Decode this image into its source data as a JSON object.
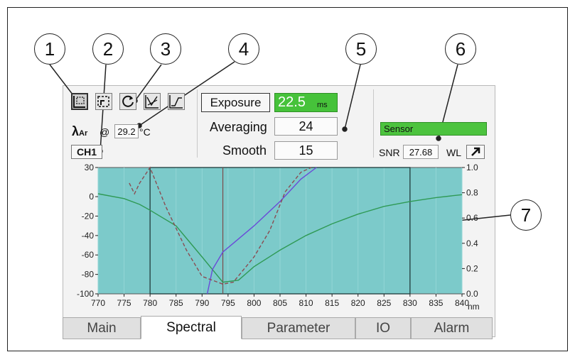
{
  "callouts": [
    "1",
    "2",
    "3",
    "4",
    "5",
    "6",
    "7"
  ],
  "toolbar": {
    "icons": [
      "zoom-rect-icon",
      "zoom-reset-icon",
      "refresh-icon",
      "curve-icon",
      "peak-icon"
    ]
  },
  "sensor_info": {
    "lambda_symbol": "λ",
    "lambda_sub": "Ar",
    "at": "@",
    "temperature": "29.2",
    "temp_unit": "°C",
    "channel": "CH1"
  },
  "acquisition": {
    "exposure_label": "Exposure",
    "exposure_value": "22.5",
    "exposure_unit": "ms",
    "averaging_label": "Averaging",
    "averaging_value": "24",
    "smooth_label": "Smooth",
    "smooth_value": "15"
  },
  "status": {
    "sensor_label": "Sensor",
    "snr_label": "SNR",
    "snr_value": "27.68",
    "wl_label": "WL",
    "wl_button_icon": "arrow-up-right-icon"
  },
  "colors": {
    "plot_bg": "#7ccaca",
    "exposure_green": "#46c23a",
    "sensor_green": "#4cc33e",
    "curve_green": "#2f9a55",
    "curve_purple": "#6a4ad8",
    "curve_dashed": "#8a4c52",
    "window_line": "#1f3b3b"
  },
  "chart_data": {
    "type": "line",
    "x_unit": "nm",
    "xlim": [
      770,
      840
    ],
    "ylim_left": [
      -100,
      30
    ],
    "ylim_right": [
      0.0,
      1.0
    ],
    "x_ticks": [
      770,
      775,
      780,
      785,
      790,
      795,
      800,
      805,
      810,
      815,
      820,
      825,
      830,
      835,
      840
    ],
    "y_ticks_left": [
      30,
      0,
      -20,
      -40,
      -60,
      -80,
      -100
    ],
    "y_ticks_right": [
      "1.0",
      "0.8",
      "0.6",
      "0.4",
      "0.2",
      "0.0"
    ],
    "window_nm": [
      780,
      830
    ],
    "marker_nm": 794,
    "grid": true,
    "series": [
      {
        "style": "solid-green",
        "x": [
          770,
          775,
          778,
          780,
          785,
          790,
          794,
          797,
          800,
          805,
          810,
          815,
          820,
          825,
          830,
          835,
          840
        ],
        "y": [
          3,
          -2,
          -8,
          -14,
          -30,
          -62,
          -88,
          -86,
          -72,
          -55,
          -40,
          -28,
          -18,
          -10,
          -5,
          -1,
          2
        ]
      },
      {
        "style": "solid-purple",
        "x": [
          791,
          792,
          794,
          796,
          800,
          805,
          809,
          812
        ],
        "y": [
          -100,
          -75,
          -57,
          -48,
          -30,
          -5,
          18,
          30
        ]
      },
      {
        "style": "dashed-brown",
        "x": [
          776,
          777,
          778,
          780,
          783,
          787,
          790,
          794,
          796,
          800,
          803,
          806,
          809,
          811
        ],
        "y": [
          14,
          3,
          14,
          30,
          -10,
          -55,
          -82,
          -90,
          -88,
          -62,
          -35,
          5,
          25,
          30
        ]
      }
    ]
  }
}
